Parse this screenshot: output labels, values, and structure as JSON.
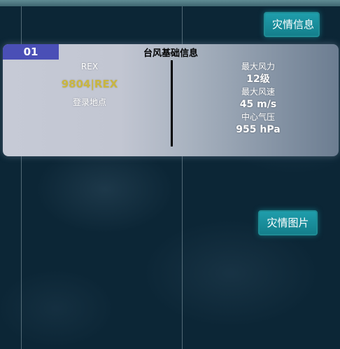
{
  "buttons": {
    "disaster_info": "灾情信息",
    "disaster_pictures": "灾情图片"
  },
  "typhoon_card": {
    "index": "01",
    "title": "台风基础信息",
    "name": "REX",
    "code": "9804|REX",
    "landfall_label": "登录地点",
    "max_wind_force_label": "最大风力",
    "max_wind_force": "12级",
    "max_wind_speed_label": "最大风速",
    "max_wind_speed": "45 m/s",
    "center_pressure_label": "中心气压",
    "center_pressure": "955 hPa"
  },
  "colors": {
    "background": "#0c2636",
    "button": "#1a8f9c",
    "index_badge": "#4a4fb6",
    "code_text": "#c9b640"
  }
}
